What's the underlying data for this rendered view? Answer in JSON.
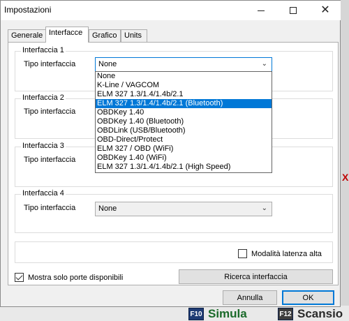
{
  "window": {
    "title": "Impostazioni"
  },
  "tabs": [
    {
      "label": "Generale",
      "active": false
    },
    {
      "label": "Interfacce",
      "active": true
    },
    {
      "label": "Grafico",
      "active": false
    },
    {
      "label": "Units",
      "active": false
    }
  ],
  "groups": [
    {
      "label": "Interfaccia 1",
      "field_label": "Tipo interfaccia",
      "value": "None",
      "open": true
    },
    {
      "label": "Interfaccia 2",
      "field_label": "Tipo interfaccia",
      "value": ""
    },
    {
      "label": "Interfaccia 3",
      "field_label": "Tipo interfaccia",
      "value": ""
    },
    {
      "label": "Interfaccia 4",
      "field_label": "Tipo interfaccia",
      "value": "None"
    }
  ],
  "dropdown": {
    "options": [
      "None",
      "K-Line / VAGCOM",
      "ELM 327 1.3/1.4/1.4b/2.1",
      "ELM 327 1.3/1.4/1.4b/2.1 (Bluetooth)",
      "OBDKey 1.40",
      "OBDKey 1.40 (Bluetooth)",
      "OBDLink (USB/Bluetooth)",
      "OBD-Direct/Protect",
      "ELM 327 / OBD (WiFi)",
      "OBDKey 1.40 (WiFi)",
      "ELM 327 1.3/1.4/1.4b/2.1 (High Speed)"
    ],
    "highlighted": "ELM 327 1.3/1.4/1.4b/2.1 (Bluetooth)"
  },
  "latency_checkbox": {
    "label": "Modalità latenza alta",
    "checked": false
  },
  "ports_checkbox": {
    "label": "Mostra solo porte disponibili",
    "checked": true
  },
  "buttons": {
    "search": "Ricerca interfaccia",
    "cancel": "Annulla",
    "ok": "OK"
  },
  "background_app": {
    "f10_key": "F10",
    "f10_label": "Simula",
    "f12_key": "F12",
    "f12_label": "Scansio",
    "right_fragment": "X"
  },
  "colors": {
    "selection": "#0078d7",
    "f10_key_bg": "#1e3b74",
    "f10_label": "#1b6a2a"
  }
}
